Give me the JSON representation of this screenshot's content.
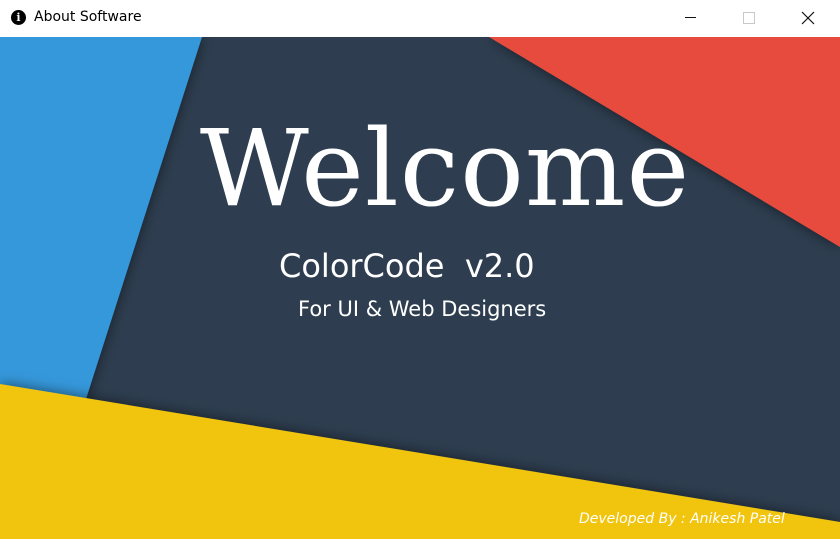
{
  "window": {
    "title": "About Software",
    "icon": "info-icon",
    "controls": [
      "minimize-icon",
      "maximize-icon",
      "close-icon"
    ]
  },
  "splash": {
    "heading": "Welcome",
    "product": "ColorCode  v2.0",
    "tagline": "For UI & Web Designers",
    "credit": "Developed By : Anikesh Patel"
  },
  "colors": {
    "background": "#2e3e50",
    "blue": "#3498db",
    "red": "#e74c3c",
    "yellow": "#f1c40f",
    "text": "#ffffff"
  }
}
